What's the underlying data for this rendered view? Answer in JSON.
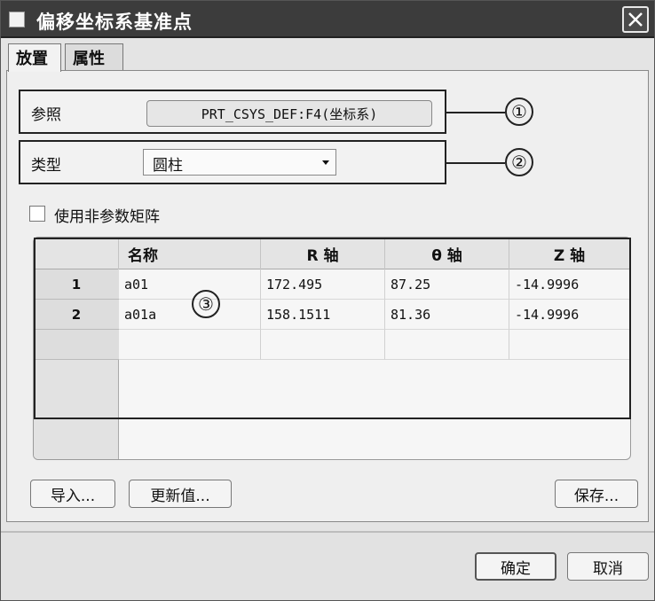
{
  "window": {
    "title": "偏移坐标系基准点"
  },
  "tabs": [
    {
      "label": "放置"
    },
    {
      "label": "属性"
    }
  ],
  "reference": {
    "label": "参照",
    "value": "PRT_CSYS_DEF:F4(坐标系)"
  },
  "type": {
    "label": "类型",
    "value": "圆柱"
  },
  "checkbox": {
    "label": "使用非参数矩阵",
    "checked": false
  },
  "callouts": [
    "①",
    "②",
    "③"
  ],
  "table": {
    "columns": [
      "名称",
      "R 轴",
      "θ 轴",
      "Z 轴"
    ],
    "rows": [
      {
        "index": "1",
        "name": "a01",
        "r": "172.495",
        "theta": "87.25",
        "z": "-14.9996"
      },
      {
        "index": "2",
        "name": "a01a",
        "r": "158.1511",
        "theta": "81.36",
        "z": "-14.9996"
      }
    ]
  },
  "buttons": {
    "import": "导入...",
    "update": "更新值...",
    "save": "保存...",
    "ok": "确定",
    "cancel": "取消"
  }
}
